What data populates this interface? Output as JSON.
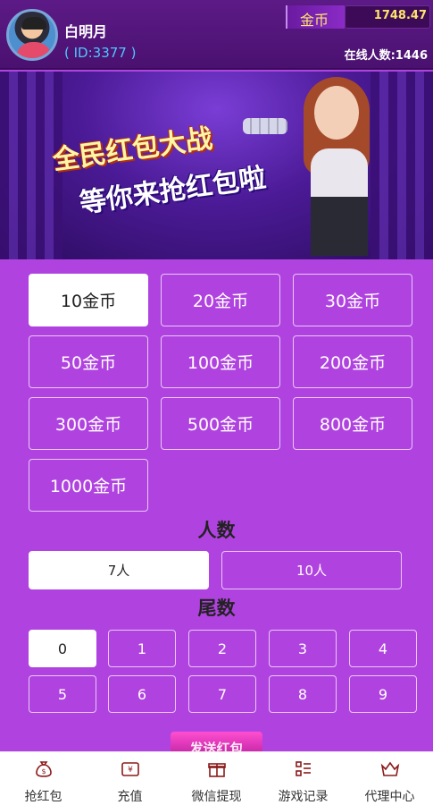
{
  "user": {
    "name": "白明月",
    "id_text": "( ID:3377 )"
  },
  "coins": {
    "label": "金币",
    "value": "1748.47"
  },
  "online": {
    "text": "在线人数:1446"
  },
  "banner": {
    "line1": "全民红包大战",
    "line2": "等你来抢红包啦"
  },
  "amounts": [
    {
      "label": "10金币",
      "selected": true
    },
    {
      "label": "20金币",
      "selected": false
    },
    {
      "label": "30金币",
      "selected": false
    },
    {
      "label": "50金币",
      "selected": false
    },
    {
      "label": "100金币",
      "selected": false
    },
    {
      "label": "200金币",
      "selected": false
    },
    {
      "label": "300金币",
      "selected": false
    },
    {
      "label": "500金币",
      "selected": false
    },
    {
      "label": "800金币",
      "selected": false
    },
    {
      "label": "1000金币",
      "selected": false
    }
  ],
  "people": {
    "title": "人数",
    "options": [
      {
        "label": "7人",
        "selected": true
      },
      {
        "label": "10人",
        "selected": false
      }
    ]
  },
  "tail": {
    "title": "尾数",
    "options": [
      {
        "label": "0",
        "selected": true
      },
      {
        "label": "1",
        "selected": false
      },
      {
        "label": "2",
        "selected": false
      },
      {
        "label": "3",
        "selected": false
      },
      {
        "label": "4",
        "selected": false
      },
      {
        "label": "5",
        "selected": false
      },
      {
        "label": "6",
        "selected": false
      },
      {
        "label": "7",
        "selected": false
      },
      {
        "label": "8",
        "selected": false
      },
      {
        "label": "9",
        "selected": false
      }
    ]
  },
  "send_button": {
    "label": "发送红包"
  },
  "nav": [
    {
      "label": "抢红包",
      "icon": "money-bag-icon"
    },
    {
      "label": "充值",
      "icon": "yen-ticket-icon"
    },
    {
      "label": "微信提现",
      "icon": "gift-box-icon"
    },
    {
      "label": "游戏记录",
      "icon": "list-grid-icon"
    },
    {
      "label": "代理中心",
      "icon": "crown-icon"
    }
  ],
  "colors": {
    "background": "#b043e0",
    "header": "#4a1170",
    "gold": "#ffe36e",
    "id_blue": "#4fc7ff",
    "nav_icon": "#8b1a1a"
  }
}
